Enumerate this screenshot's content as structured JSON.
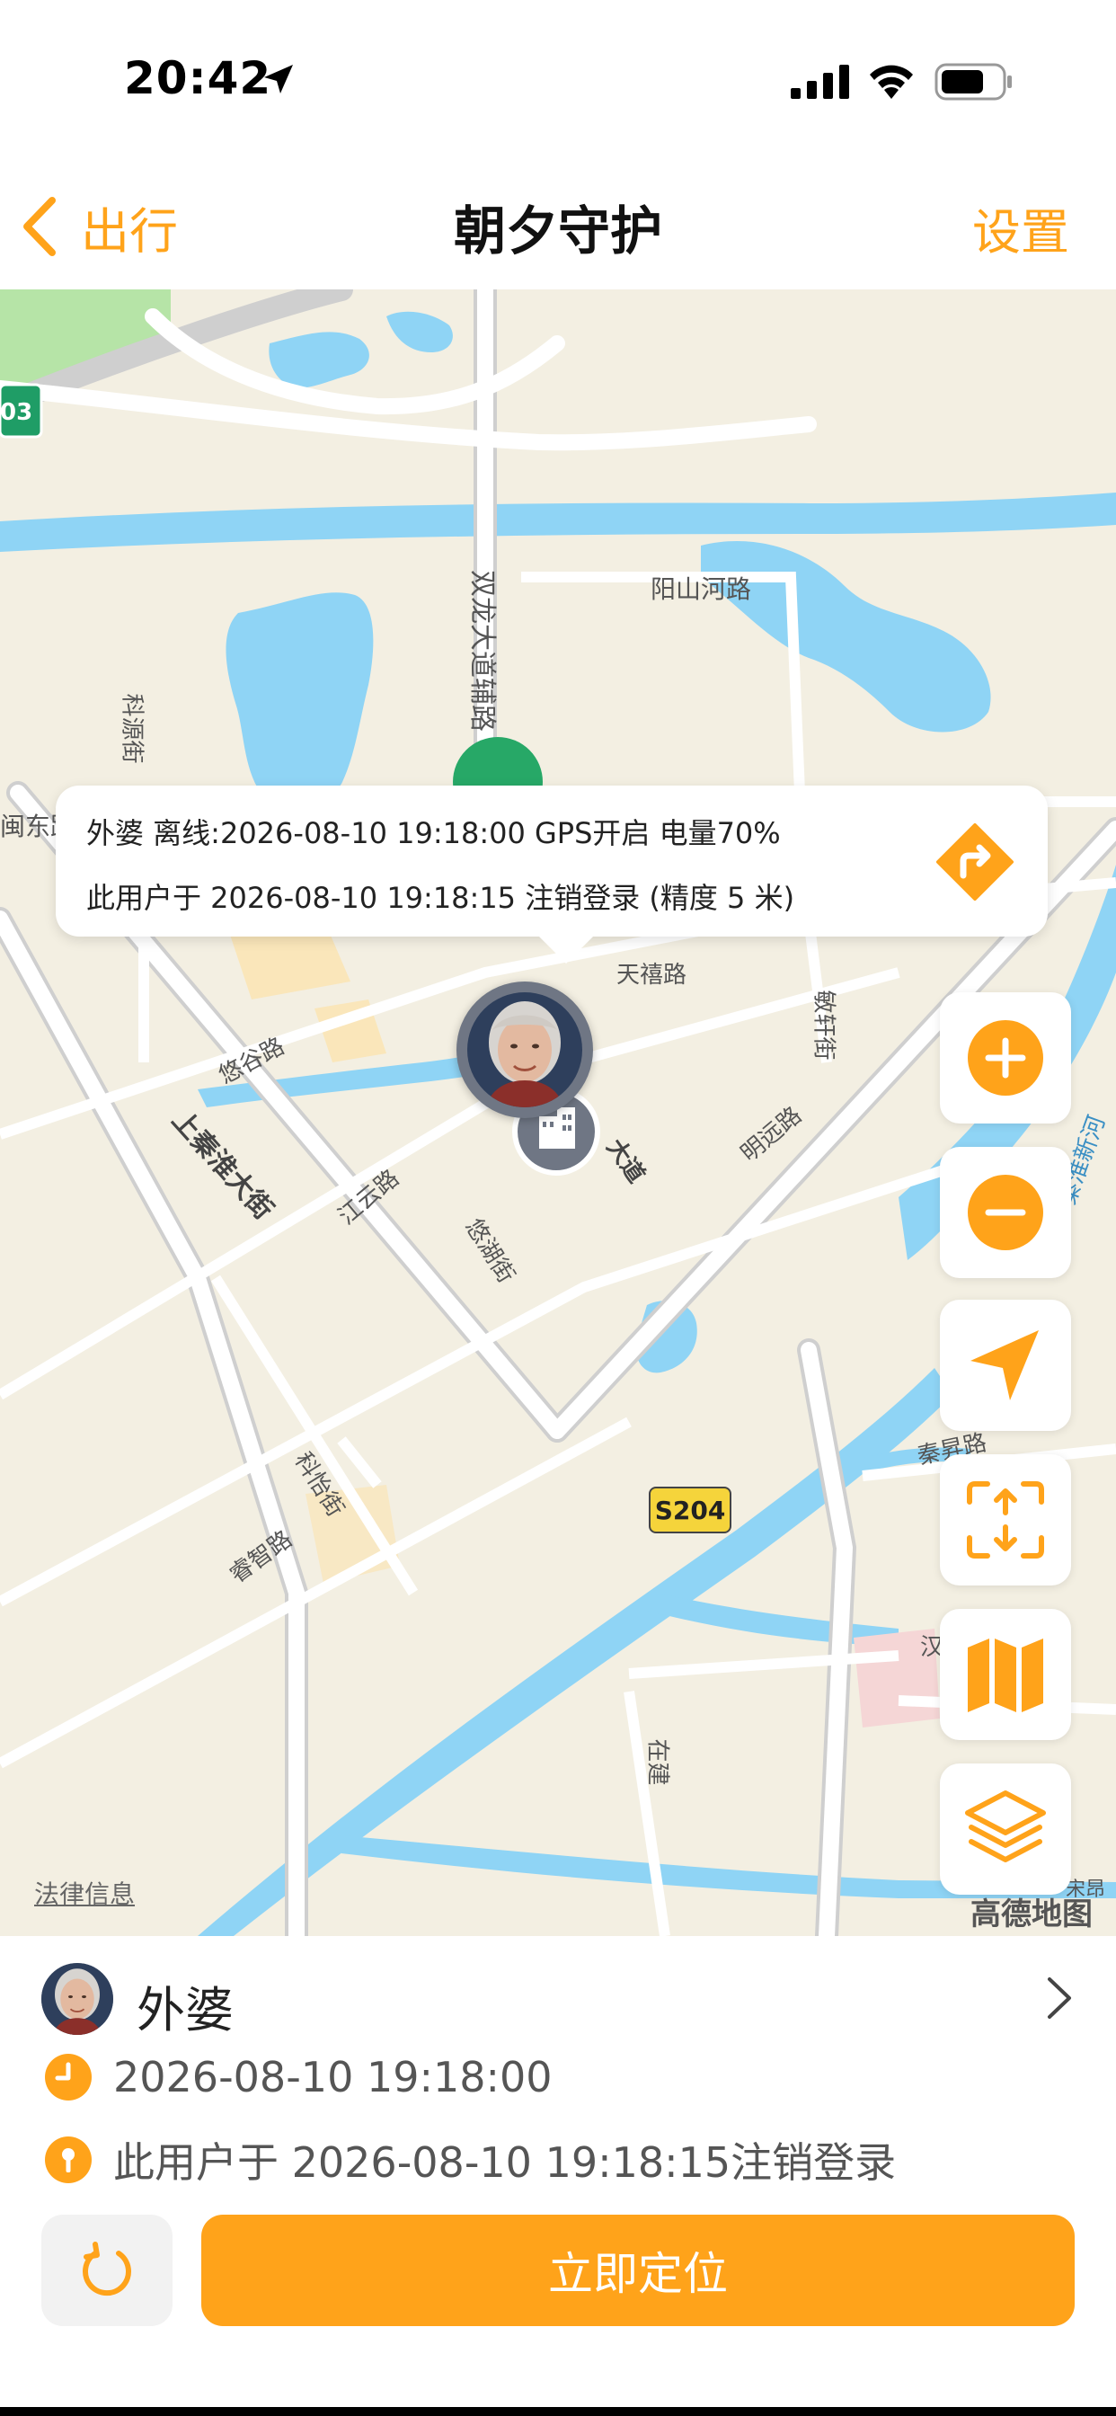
{
  "status_bar": {
    "time": "20:42",
    "icons": [
      "location-arrow-icon",
      "cellular-signal-icon",
      "wifi-icon",
      "battery-icon"
    ]
  },
  "nav": {
    "back_label": "出行",
    "title": "朝夕守护",
    "settings_label": "设置"
  },
  "map": {
    "callout": {
      "line1": "外婆 离线:2026-08-10 19:18:00 GPS开启 电量70%",
      "line2": "此用户于 2026-08-10 19:18:15 注销登录 (精度 5 米)"
    },
    "road_labels": {
      "shuanglong": "双龙大道辅路",
      "yangshan": "阳山河路",
      "kexi": "科源街",
      "dongpu": "闽东路",
      "tianxi": "天禧路",
      "minxuan": "敏轩街",
      "yougu": "悠谷路",
      "shangqinhuai": "上秦淮大街",
      "jiangyun": "江云路",
      "mingyuan": "明远路",
      "dadao": "大道",
      "youhu": "悠湖街",
      "kehe": "科怡街",
      "liangzhi": "睿智路",
      "qinju": "秦昇路",
      "zaijian": "在建",
      "han": "汉",
      "songju": "宋昂",
      "river": "秦淮新河"
    },
    "road_shield_left": "03",
    "road_shield": "S204",
    "legal_link": "法律信息",
    "map_logo": "高德地图",
    "controls": [
      "zoom-in",
      "zoom-out",
      "locate-me",
      "fit-view",
      "map-mode",
      "layers"
    ]
  },
  "panel": {
    "name": "外婆",
    "time_row": "2026-08-10 19:18:00",
    "status_row": "此用户于 2026-08-10 19:18:15注销登录",
    "locate_button": "立即定位"
  },
  "colors": {
    "accent": "#ffa31a",
    "water": "#8fd4f5",
    "land": "#f3efe2",
    "road": "#ffffff"
  }
}
